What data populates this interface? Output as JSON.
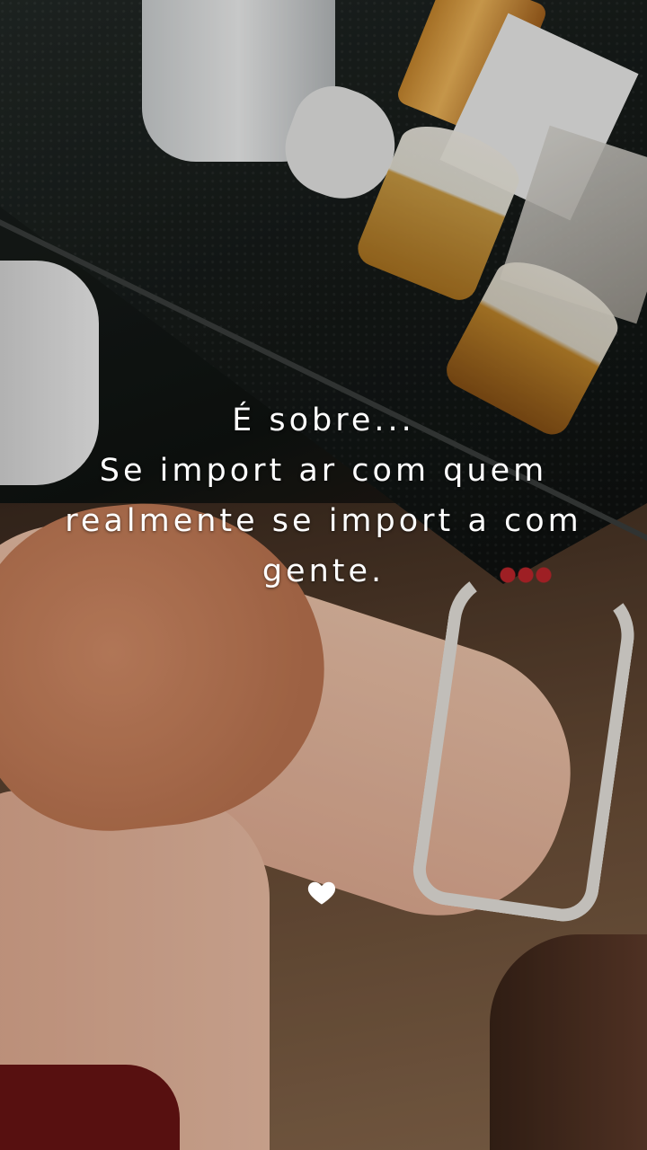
{
  "story": {
    "caption_lines": [
      "É sobre...",
      "Se import ar com quem",
      "realmente se import a com",
      "gente."
    ],
    "heart_icon": "heart-icon",
    "text_color": "#ffffff"
  }
}
